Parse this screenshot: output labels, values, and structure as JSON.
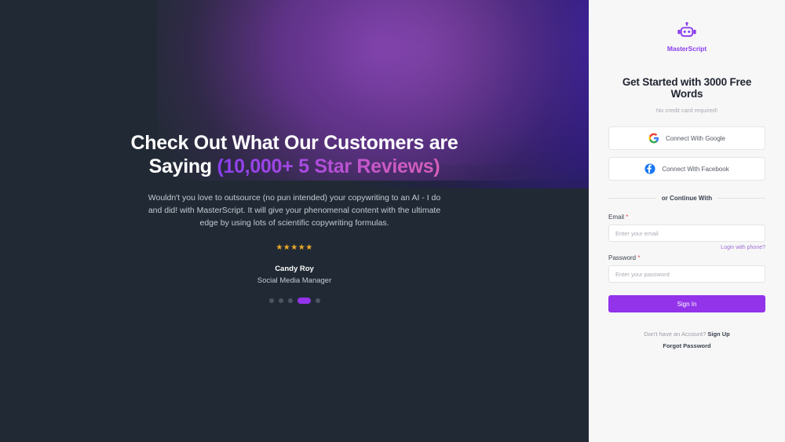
{
  "brand": {
    "name": "MasterScript",
    "logo_icon": "robot-icon",
    "accent_purple": "#9333ea",
    "logo_purple": "#8b3ff0"
  },
  "left_panel": {
    "headline_part1": "Check Out What Our Customers are Saying ",
    "headline_highlight": "(10,000+ 5 Star Reviews)",
    "paragraph": "Wouldn't you love to outsource (no pun intended) your copywriting to an AI - I do and did! with MasterScript. It will give your phenomenal content with the ultimate edge by using lots of scientific copywriting formulas.",
    "stars": "★★★★★",
    "star_count": 5,
    "star_color": "#f0a92b",
    "author_name": "Candy Roy",
    "author_role": "Social Media Manager",
    "carousel": {
      "total": 5,
      "active_index": 3
    },
    "background_base": "#212a34"
  },
  "right_panel": {
    "title": "Get Started with 3000 Free Words",
    "subtitle": "No credit card required!",
    "social_buttons": [
      {
        "label": "Connect With Google",
        "icon": "google-icon"
      },
      {
        "label": "Connect With Facebook",
        "icon": "facebook-icon"
      }
    ],
    "divider_text": "or Continue With",
    "email": {
      "label": "Email",
      "required_mark": "*",
      "placeholder": "Enter your email",
      "value": ""
    },
    "phone_link": "Login with phone?",
    "password": {
      "label": "Password",
      "required_mark": "*",
      "placeholder": "Enter your password",
      "value": ""
    },
    "submit_label": "Sign In",
    "footer_prompt": "Don't have an Account?",
    "footer_signup": "Sign Up",
    "footer_forgot": "Forgot Password",
    "background": "#f7f7f7"
  }
}
